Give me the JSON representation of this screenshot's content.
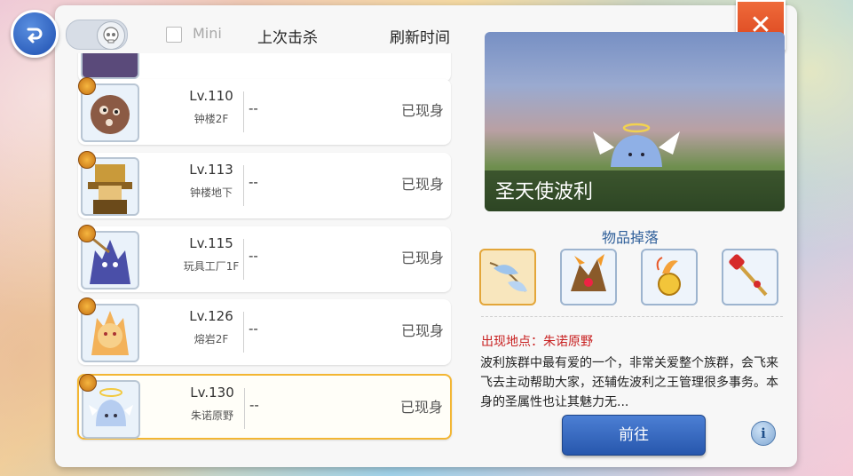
{
  "header": {
    "mini_label": "Mini",
    "last_kill_label": "上次击杀",
    "refresh_label": "刷新时间"
  },
  "mvp_list": [
    {
      "level": "Lv.110",
      "map": "钟楼2F",
      "last_kill": "--",
      "status": "已现身",
      "selected": false
    },
    {
      "level": "Lv.113",
      "map": "钟楼地下",
      "last_kill": "--",
      "status": "已现身",
      "selected": false
    },
    {
      "level": "Lv.115",
      "map": "玩具工厂1F",
      "last_kill": "--",
      "status": "已现身",
      "selected": false
    },
    {
      "level": "Lv.126",
      "map": "熔岩2F",
      "last_kill": "--",
      "status": "已现身",
      "selected": false
    },
    {
      "level": "Lv.130",
      "map": "朱诺原野",
      "last_kill": "--",
      "status": "已现身",
      "selected": true
    }
  ],
  "preview": {
    "monster_name": "圣天使波利"
  },
  "drops": {
    "title": "物品掉落",
    "items": [
      "angel-wing-item-icon",
      "dragon-helm-item-icon",
      "golden-orb-item-icon",
      "red-staff-item-icon"
    ]
  },
  "details": {
    "location": "出现地点：朱诺原野",
    "description": "波利族群中最有爱的一个，非常关爱整个族群，会飞来飞去主动帮助大家，还辅佐波利之王管理很多事务。本身的圣属性也让其魅力无..."
  },
  "actions": {
    "go_label": "前往",
    "info_label": "i",
    "close_label": "✕"
  },
  "colors": {
    "accent_blue": "#2757ad",
    "close_red": "#d8421c",
    "selected_border": "#f3b633",
    "location_red": "#c82020"
  }
}
